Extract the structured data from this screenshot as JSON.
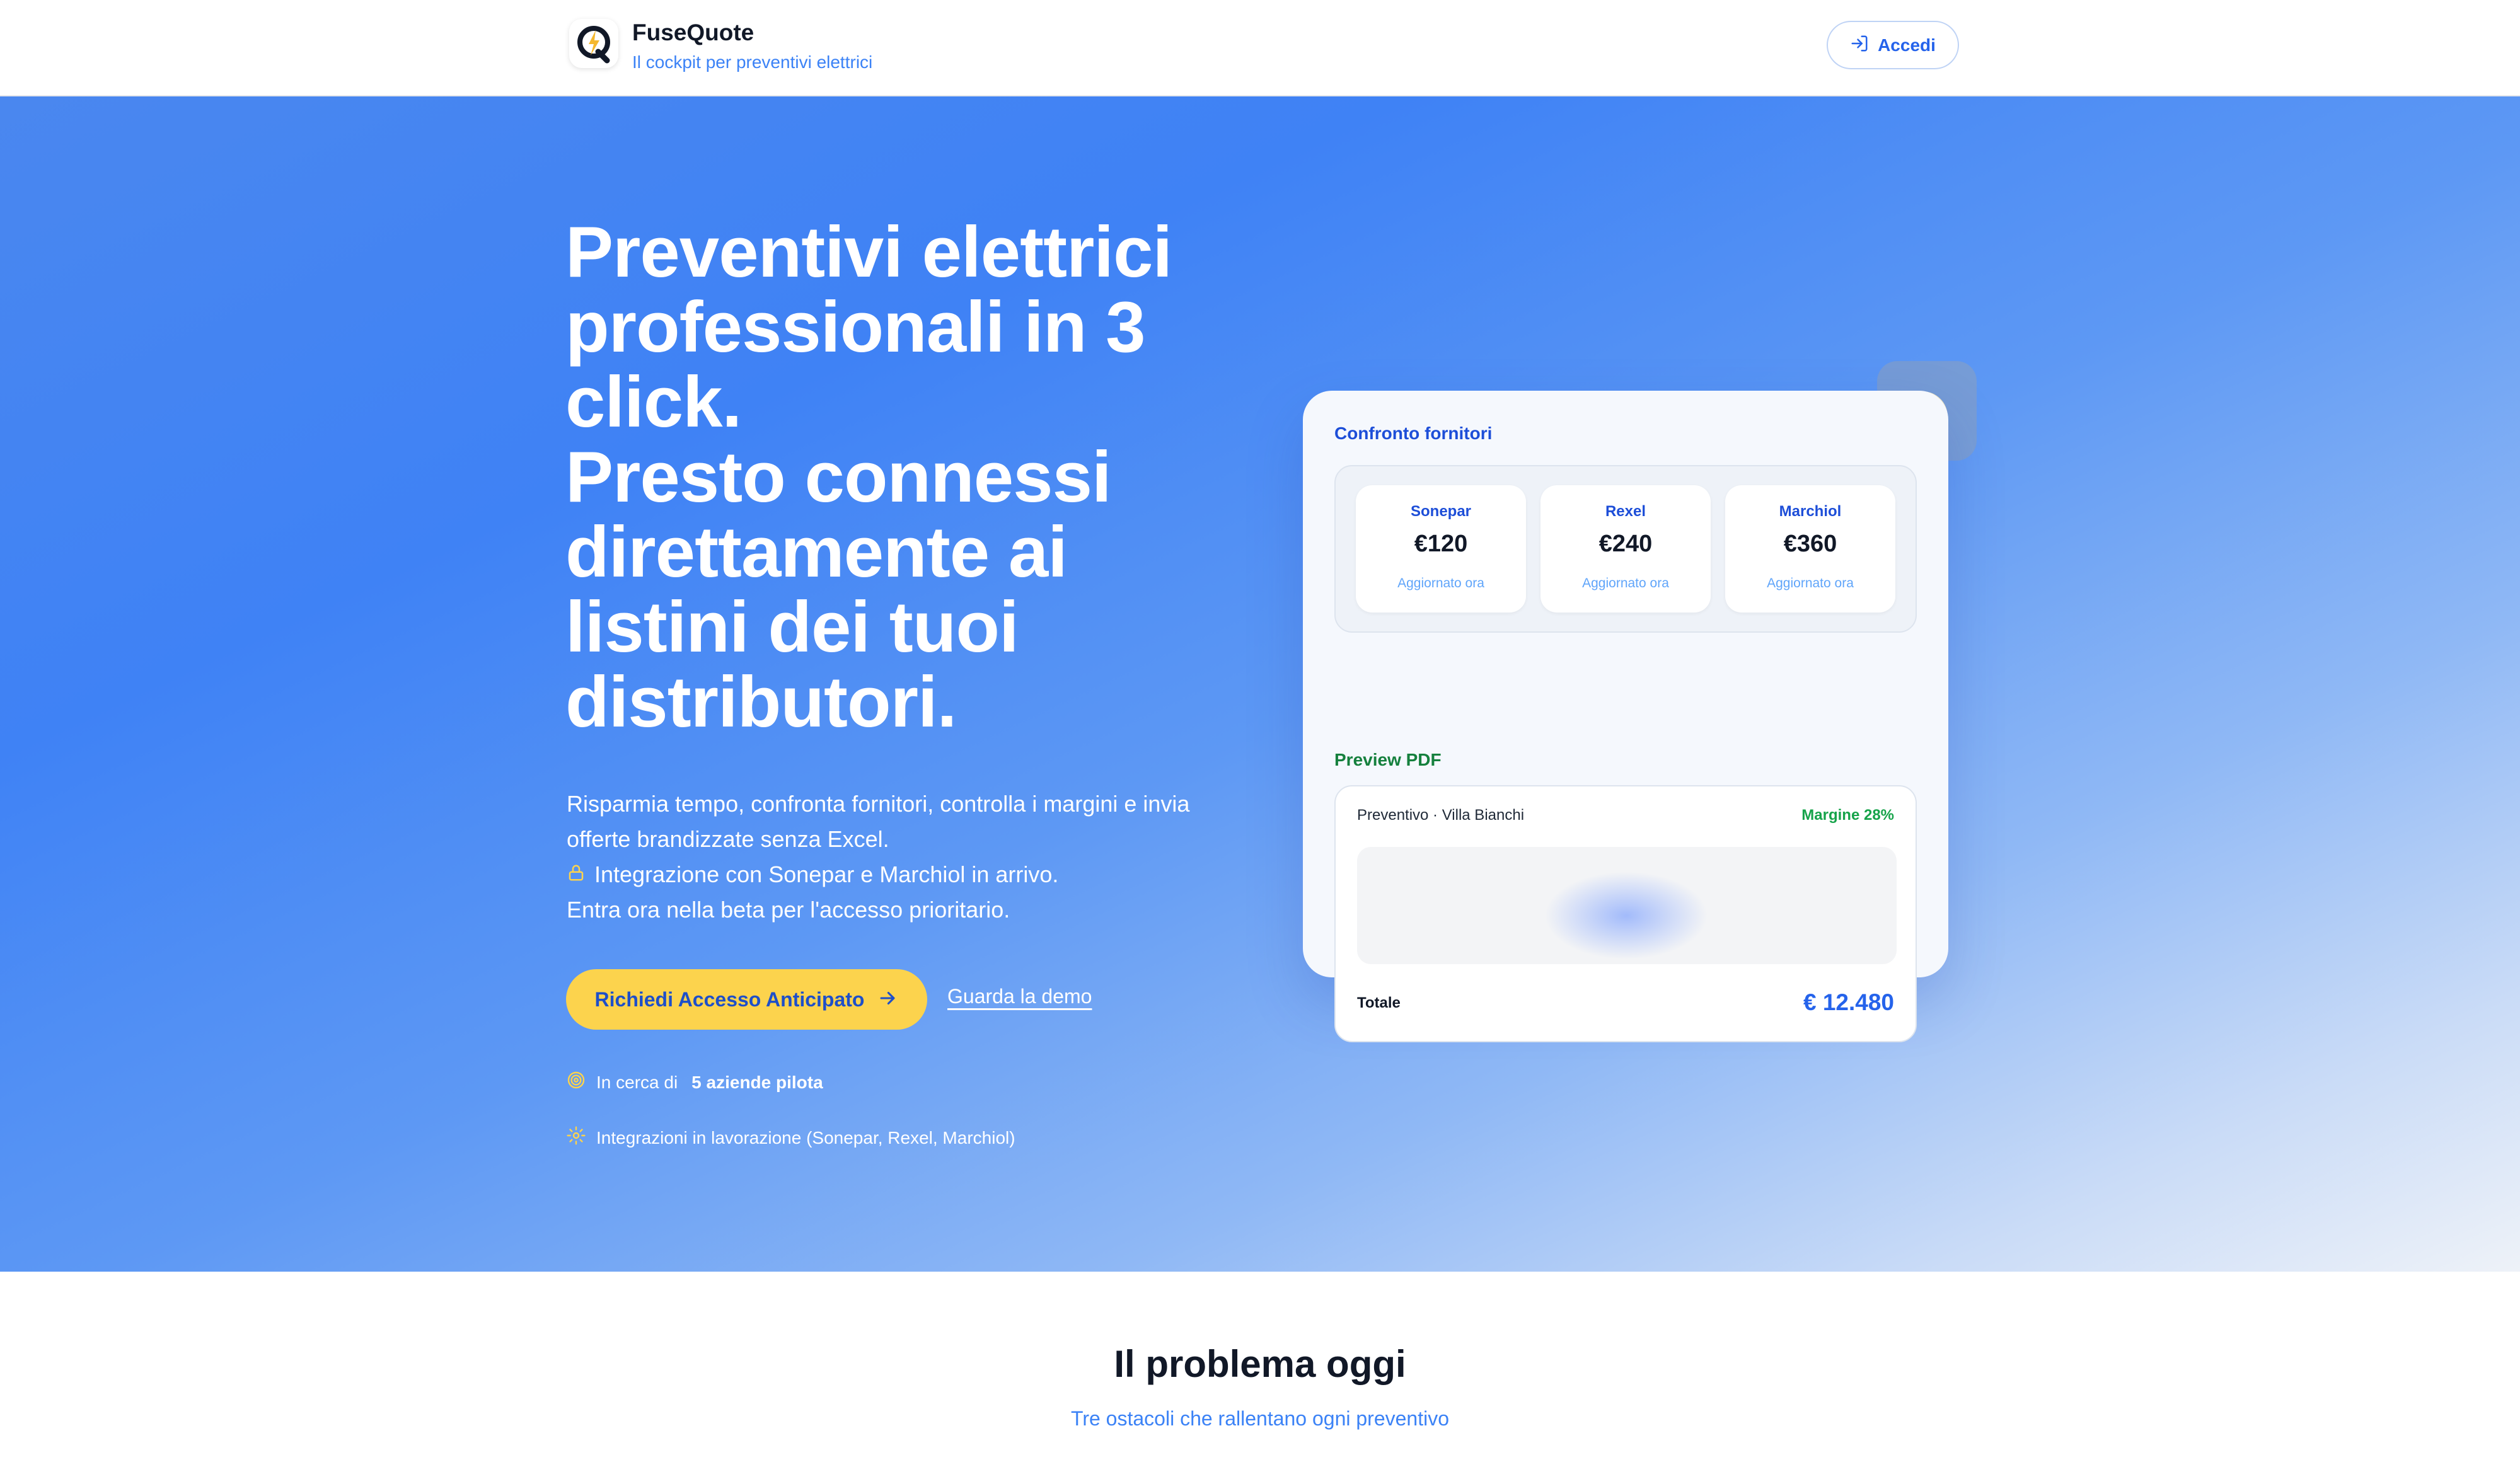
{
  "header": {
    "brand_name": "FuseQuote",
    "tagline": "Il cockpit per preventivi elettrici",
    "login_label": "Accedi",
    "logo_icon": "q-bolt-logo-icon",
    "login_icon": "sign-in-icon"
  },
  "hero": {
    "title_lines": [
      "Preventivi elettrici",
      "professionali in 3",
      "click.",
      "Presto connessi",
      "direttamente ai",
      "listini dei tuoi",
      "distributori."
    ],
    "description_lines": [
      "Risparmia tempo, confronta fornitori, controlla i margini e invia",
      "offerte brandizzate senza Excel.",
      "Integrazione con Sonepar e Marchiol in arrivo.",
      "Entra ora nella beta per l'accesso prioritario."
    ],
    "cta_label": "Richiedi Accesso Anticipato",
    "demo_label": "Guarda la demo",
    "badge1_prefix": "In cerca di",
    "badge1_bold": "5 aziende pilota",
    "badge2_text": "Integrazioni in lavorazione (Sonepar, Rexel, Marchiol)"
  },
  "card": {
    "suppliers_label": "Confronto fornitori",
    "suppliers": [
      {
        "name": "Sonepar",
        "price": "€120",
        "updated": "Aggiornato ora"
      },
      {
        "name": "Rexel",
        "price": "€240",
        "updated": "Aggiornato ora"
      },
      {
        "name": "Marchiol",
        "price": "€360",
        "updated": "Aggiornato ora"
      }
    ],
    "pdf_label": "Preview PDF",
    "pdf_title": "Preventivo · Villa Bianchi",
    "pdf_margin": "Margine 28%",
    "total_label": "Totale",
    "total_value": "€ 12.480"
  },
  "problem": {
    "title": "Il problema oggi",
    "subtitle": "Tre ostacoli che rallentano ogni preventivo"
  },
  "colors": {
    "brand_blue": "#3f82f5",
    "accent_yellow": "#fcd34d",
    "link_blue": "#2563eb",
    "margin_green": "#16a34a"
  }
}
